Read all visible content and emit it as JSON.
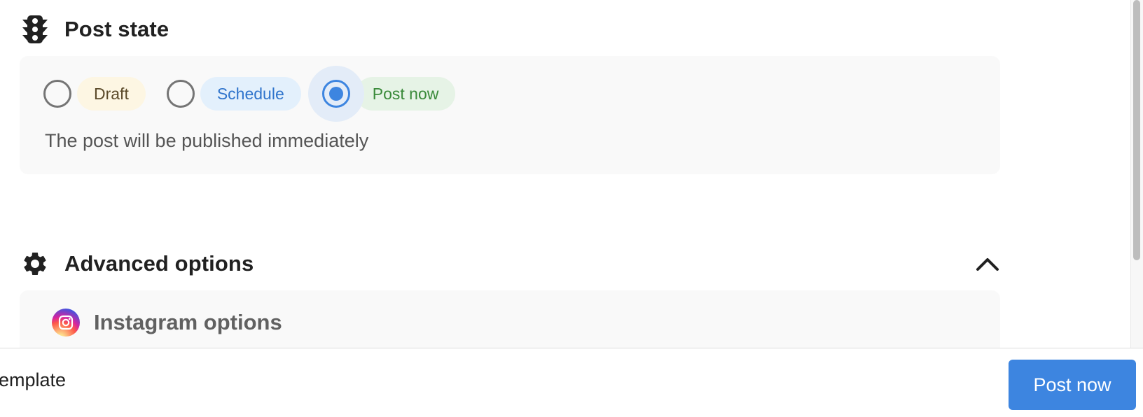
{
  "post_state": {
    "title": "Post state",
    "icon": "traffic-light-icon",
    "options": [
      {
        "label": "Draft",
        "selected": false,
        "color": "#fdf6e3"
      },
      {
        "label": "Schedule",
        "selected": false,
        "color": "#e3f0fc"
      },
      {
        "label": "Post now",
        "selected": true,
        "color": "#e6f3e6"
      }
    ],
    "status_text": "The post will be published immediately"
  },
  "advanced_options": {
    "title": "Advanced options",
    "icon": "gear-icon",
    "expanded": true,
    "collapse_icon": "chevron-up-icon",
    "instagram": {
      "icon": "instagram-icon",
      "label": "Instagram options"
    }
  },
  "footer": {
    "left_text": "emplate",
    "primary_button_label": "Post now"
  },
  "colors": {
    "accent": "#3d85e0",
    "card_background": "#f9f9f9"
  }
}
